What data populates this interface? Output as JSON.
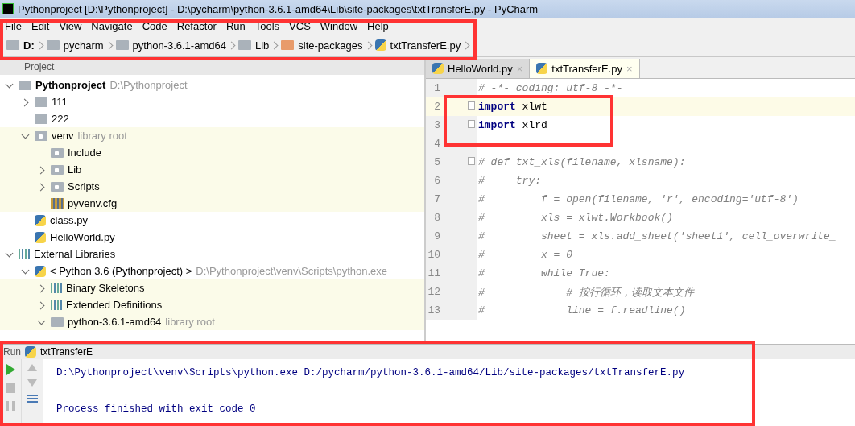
{
  "window": {
    "title": "Pythonproject [D:\\Pythonproject] - D:\\pycharm\\python-3.6.1-amd64\\Lib\\site-packages\\txtTransferE.py - PyCharm"
  },
  "menu": [
    "File",
    "Edit",
    "View",
    "Navigate",
    "Code",
    "Refactor",
    "Run",
    "Tools",
    "VCS",
    "Window",
    "Help"
  ],
  "breadcrumb": [
    {
      "label": "D:",
      "kind": "drive"
    },
    {
      "label": "pycharm",
      "kind": "folder"
    },
    {
      "label": "python-3.6.1-amd64",
      "kind": "folder"
    },
    {
      "label": "Lib",
      "kind": "folder"
    },
    {
      "label": "site-packages",
      "kind": "package"
    },
    {
      "label": "txtTransferE.py",
      "kind": "python"
    }
  ],
  "project": {
    "title": "Project",
    "tree": [
      {
        "label": "Pythonproject",
        "hint": "D:\\Pythonproject",
        "kind": "folder",
        "expanded": true,
        "highlighted": false,
        "children": [
          {
            "label": "111",
            "kind": "folder",
            "expanded": false,
            "highlighted": false
          },
          {
            "label": "222",
            "kind": "folder",
            "highlighted": false
          },
          {
            "label": "venv",
            "hint": "library root",
            "kind": "lib-folder",
            "expanded": true,
            "highlighted": true,
            "children": [
              {
                "label": "Include",
                "kind": "lib-folder",
                "highlighted": true
              },
              {
                "label": "Lib",
                "kind": "lib-folder",
                "expanded": false,
                "highlighted": true
              },
              {
                "label": "Scripts",
                "kind": "lib-folder",
                "expanded": false,
                "highlighted": true
              },
              {
                "label": "pyvenv.cfg",
                "kind": "config",
                "highlighted": true
              }
            ]
          },
          {
            "label": "class.py",
            "kind": "python",
            "highlighted": false
          },
          {
            "label": "HelloWorld.py",
            "kind": "python",
            "highlighted": false
          }
        ]
      },
      {
        "label": "External Libraries",
        "kind": "libraries",
        "expanded": true,
        "highlighted": false,
        "children": [
          {
            "label": "< Python 3.6 (Pythonproject) >",
            "hint": "D:\\Pythonproject\\venv\\Scripts\\python.exe",
            "kind": "sdk",
            "expanded": true,
            "highlighted": false,
            "children": [
              {
                "label": "Binary Skeletons",
                "kind": "libraries",
                "expanded": false,
                "highlighted": true
              },
              {
                "label": "Extended Definitions",
                "kind": "libraries",
                "expanded": false,
                "highlighted": true
              },
              {
                "label": "python-3.6.1-amd64",
                "hint": "library root",
                "kind": "folder",
                "expanded": true,
                "highlighted": true
              }
            ]
          }
        ]
      }
    ]
  },
  "editor": {
    "tabs": [
      {
        "label": "HelloWorld.py",
        "close": "×",
        "selected": false
      },
      {
        "label": "txtTransferE.py",
        "close": "×",
        "selected": true
      }
    ],
    "lines": [
      {
        "number": "1",
        "kind": "comment",
        "text": "# -*- coding: utf-8 -*-",
        "current": false
      },
      {
        "number": "2",
        "kind": "code",
        "text": "**import** xlwt",
        "current": true,
        "fold_start": true
      },
      {
        "number": "3",
        "kind": "code",
        "text": "**import** xlrd",
        "current": false,
        "fold_end": true
      },
      {
        "number": "4",
        "current": false
      },
      {
        "number": "5",
        "kind": "comment",
        "text": "# def txt_xls(filename, xlsname):",
        "current": false,
        "fold_start": true
      },
      {
        "number": "6",
        "kind": "comment",
        "text": "#     try:",
        "current": false
      },
      {
        "number": "7",
        "kind": "comment",
        "text": "#         f = open(filename, 'r', encoding='utf-8')",
        "current": false
      },
      {
        "number": "8",
        "kind": "comment",
        "text": "#         xls = xlwt.Workbook()",
        "current": false
      },
      {
        "number": "9",
        "kind": "comment",
        "text": "#         sheet = xls.add_sheet('sheet1', cell_overwrite_",
        "current": false
      },
      {
        "number": "10",
        "kind": "comment",
        "text": "#         x = 0",
        "current": false
      },
      {
        "number": "11",
        "kind": "comment",
        "text": "#         while True:",
        "current": false
      },
      {
        "number": "12",
        "kind": "comment",
        "text": "#             # 按行循环，读取文本文件",
        "current": false
      },
      {
        "number": "13",
        "kind": "comment",
        "text": "#             line = f.readline()",
        "current": false
      }
    ]
  },
  "run": {
    "label": "Run",
    "config": "txtTransferE",
    "output": [
      "D:\\Pythonproject\\venv\\Scripts\\python.exe D:/pycharm/python-3.6.1-amd64/Lib/site-packages/txtTransferE.py",
      "Process finished with exit code 0"
    ]
  }
}
